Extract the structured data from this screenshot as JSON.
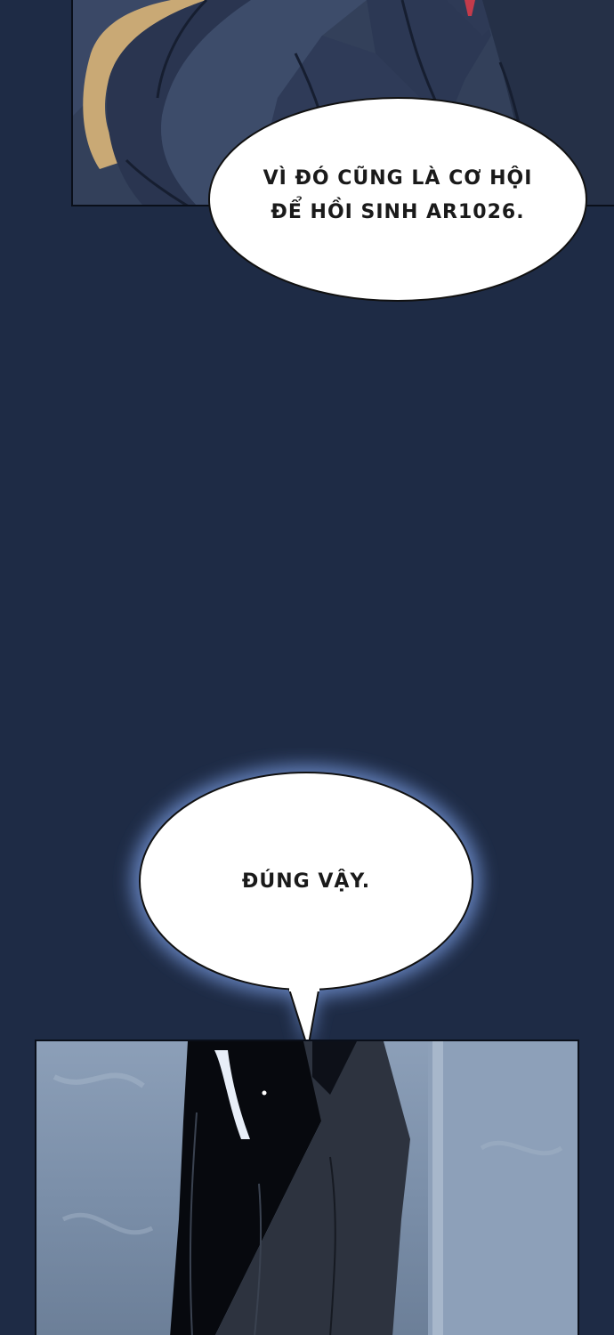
{
  "scene": {
    "background_color": "#1e2b45",
    "bubble_color": "#ffffff",
    "glow_color": "#6f90d0"
  },
  "dialogue": [
    {
      "lines": [
        "Vì đó cũng là cơ hội",
        "để hồi sinh AR1026."
      ]
    },
    {
      "lines": [
        "Đúng vậy."
      ]
    }
  ]
}
